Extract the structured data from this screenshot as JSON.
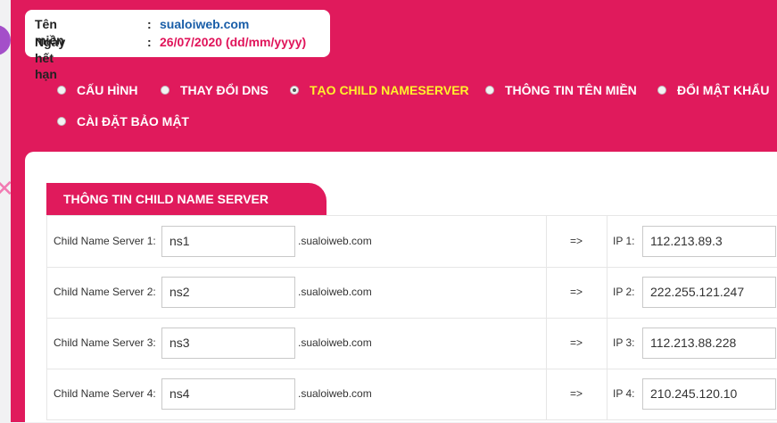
{
  "domain_info": {
    "domain_label": "Tên miền",
    "domain_value": "sualoiweb.com",
    "expiry_label": "Ngày hết hạn",
    "expiry_value": "26/07/2020 (dd/mm/yyyy)",
    "colon": ":"
  },
  "nav": {
    "items": [
      {
        "label": "CẤU HÌNH",
        "selected": false
      },
      {
        "label": "THAY ĐỔI DNS",
        "selected": false
      },
      {
        "label": "TẠO CHILD NAMESERVER",
        "selected": true
      },
      {
        "label": "THÔNG TIN TÊN MIỀN",
        "selected": false
      },
      {
        "label": "ĐỔI MẬT KHẨU",
        "selected": false
      },
      {
        "label": "CÀI ĐẶT BẢO MẬT",
        "selected": false
      }
    ]
  },
  "section": {
    "title": "THÔNG TIN CHILD NAME SERVER",
    "arrow": "=>",
    "rows": [
      {
        "label": "Child Name Server 1:",
        "ns_value": "ns1",
        "suffix": ".sualoiweb.com",
        "ip_label": "IP 1:",
        "ip_value": "112.213.89.3"
      },
      {
        "label": "Child Name Server 2:",
        "ns_value": "ns2",
        "suffix": ".sualoiweb.com",
        "ip_label": "IP 2:",
        "ip_value": "222.255.121.247"
      },
      {
        "label": "Child Name Server 3:",
        "ns_value": "ns3",
        "suffix": ".sualoiweb.com",
        "ip_label": "IP 3:",
        "ip_value": "112.213.88.228"
      },
      {
        "label": "Child Name Server 4:",
        "ns_value": "ns4",
        "suffix": ".sualoiweb.com",
        "ip_label": "IP 4:",
        "ip_value": "210.245.120.10"
      }
    ]
  },
  "colors": {
    "brand_pink": "#e01a5c",
    "active_nav": "#fff12c",
    "domain_link": "#1a5ea8"
  }
}
